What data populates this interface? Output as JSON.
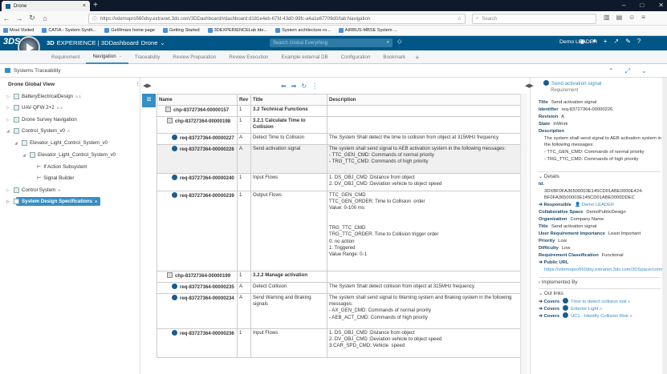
{
  "browser": {
    "tab_title": "Drone",
    "url": "https://vdemopro560dsy.extranet.3ds.com/3DDashboard/#dashboard:d181e4eb-67fd-43d0-99fc-a4a1e67709d0/tab:Navigation",
    "search_placeholder": "Search",
    "bookmarks": [
      "Most Visited",
      "CATIA - System Synth...",
      "GeWmars home page",
      "Getting Started",
      "3DEXPERIENCELab Ide...",
      "System architecture ro...",
      "AIRBUS-MBSE System ..."
    ]
  },
  "header": {
    "logo": "3DS",
    "brand": "3D",
    "app": "EXPERIENCE | 3DDashboard",
    "dashboard": "Drone",
    "search_placeholder": "Search Global Everything",
    "user": "Demo LEADER"
  },
  "tabs": [
    "Requirement",
    "Navigation",
    "Traceability",
    "Review Preparation",
    "Review Execution",
    "Example external DB",
    "Configuration",
    "Bookmark"
  ],
  "widget": {
    "title": "Systems Traceability"
  },
  "tree": {
    "title": "Drone Global View",
    "nodes": [
      {
        "label": "BatteryElectricalDesign",
        "sup": "A.1"
      },
      {
        "label": "UAV QFW 2+2",
        "sup": "A.1"
      },
      {
        "label": "Drone Survey Navigation",
        "sup": ""
      },
      {
        "label": "Control_System_v0",
        "sup": "A"
      },
      {
        "label": "Elevator_Light_Control_System_v0",
        "sup": ""
      },
      {
        "label": "Elevator_Light_Control_System_v0",
        "sup": ""
      },
      {
        "label": "If Action Subsystem",
        "sup": ""
      },
      {
        "label": "Signal Builder",
        "sup": ""
      },
      {
        "label": "Control System",
        "sup": "A"
      },
      {
        "label": "System Design Specifications",
        "sup": "A"
      }
    ]
  },
  "grid": {
    "columns": [
      "Name",
      "Rev",
      "Title",
      "Description"
    ],
    "rows": [
      {
        "name": "chp-83727364-00000157",
        "rev": "1",
        "title": "3.2 Technical Functions",
        "desc": "",
        "kind": "chapter"
      },
      {
        "name": "chp-83727364-00000198",
        "rev": "1",
        "title": "3.2.1 Calculate Time to Collision",
        "desc": "",
        "kind": "chapter"
      },
      {
        "name": "req-83727364-00000227",
        "rev": "A",
        "title": "Detect Time to Collision",
        "desc": "The System Shall detect the time to collision from object at 315MHz frequency.",
        "kind": "req"
      },
      {
        "name": "req-83727364-00000226",
        "rev": "A",
        "title": "Send activation signal",
        "desc": "The system shall send signal to AEB activation system in the following messages:\n- TTC_GEN_CMD: Commands of normal priority\n- TRG_TTC_CMD: Commands of high priority",
        "kind": "req"
      },
      {
        "name": "req-83727364-00000240",
        "rev": "1",
        "title": "Input Flows",
        "desc": "1. DS_OBJ_CMD :Distance from object\n2. DV_OBJ_CMD :Deviation vehicle to object speed",
        "kind": "req"
      },
      {
        "name": "req-83727364-00000239",
        "rev": "1",
        "title": "Output Flows",
        "desc": "TTC_GEN_CMD\nTTC_GEN_ORDER: Time to Collision  order\nValue: 0-100 ms\n\n\nTRG_TTC_CMD\nTRG_TTC_ORDER: Time to Collision trigger order\n0: no action\n1: Triggered\nValue Range: 0-1",
        "kind": "req"
      },
      {
        "name": "chp-83727364-00000199",
        "rev": "1",
        "title": "3.2.2 Manage activation",
        "desc": "",
        "kind": "chapter"
      },
      {
        "name": "req-83727364-00000235",
        "rev": "A",
        "title": "Detect Collision",
        "desc": "The System Shall detect collision from object at 315MHz frequency.",
        "kind": "req"
      },
      {
        "name": "req-83727364-00000234",
        "rev": "A",
        "title": "Send Warning and Braking signals",
        "desc": "The system shall send signal to Warning system and Braking system in the following\nmessages:\n- AX_GEN_CMD: Commands of normal priority\n- AEB_ACT_CMD: Commands of high priority",
        "kind": "req"
      },
      {
        "name": "req-83727364-00000236",
        "rev": "1",
        "title": "Input Flows",
        "desc": "1. DS_OBJ_CMD :Distance from object\n2. DV_OBJ_CMD :Deviation vehicle to object speed\n3.CAR_SPD_CMD: Vehicle  speed",
        "kind": "req"
      }
    ]
  },
  "panel": {
    "title": "Send activation signal",
    "subtitle": "Requirement",
    "fields": {
      "title_label": "Title",
      "title_value": "Send activation signal",
      "identifier_label": "Identifier",
      "identifier_value": "req-83727364-00000226",
      "revision_label": "Revision",
      "revision_value": "A",
      "state_label": "State",
      "state_value": "InWork",
      "description_label": "Description",
      "description_lines": [
        "The system shall send signal to AEB activation system in",
        "the following messages:",
        "- TTC_GEN_CMD: Commands of normal priority",
        "- TRG_TTC_CMD: Commands of high priority"
      ]
    },
    "details": {
      "section": "Details",
      "id_label": "Id.",
      "id_lines": [
        "3DXBF0FA36500003E145CD01ABE0000E424-",
        "BF0FA36500003E145CD01ABE0000DDEC"
      ],
      "responsible_label": "Responsible",
      "responsible_value": "Demo LEADER",
      "cs_label": "Collaborative Space",
      "cs_value": "DemoPublicDesign",
      "org_label": "Organization",
      "org_value": "Company Name",
      "title_label": "Title",
      "title_value": "Send activation signal",
      "uri_label": "User Requirement Importance",
      "uri_value": "Least Important",
      "priority_label": "Priority",
      "priority_value": "Low",
      "difficulty_label": "Difficulty",
      "difficulty_value": "Low",
      "rc_label": "Requirement Classification",
      "rc_value": "Functional",
      "public_url_label": "Public URL",
      "public_url_value": "https://vdemopro560dsy.extranet.3ds.com/3DSpace/comr"
    },
    "implemented_by": "Implemented By",
    "outlinks": {
      "section": "Out links",
      "links": [
        {
          "rel": "Covers",
          "target": "Time to detect collision risk",
          "sup": "A"
        },
        {
          "rel": "Covers",
          "target": "Exterior Light",
          "sup": "A"
        },
        {
          "rel": "Covers",
          "target": "UC1 - Identify Collision Risk",
          "sup": "A"
        }
      ]
    }
  }
}
